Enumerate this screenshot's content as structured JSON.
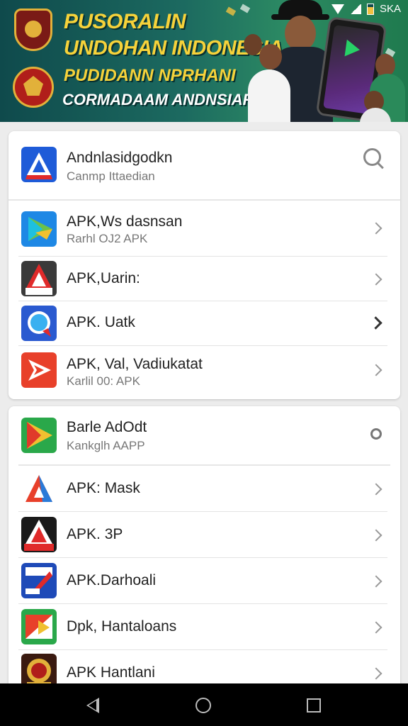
{
  "status_bar": {
    "carrier": "SKA"
  },
  "banner": {
    "line1": "PUSORALIN",
    "line2": "UNDOHAN INDONESIA",
    "line3": "PUDIDANN NPRHANI",
    "line4": "CORMADAAM ANDNSIAR"
  },
  "section1": {
    "header": {
      "title": "Andnlasidgodkn",
      "subtitle": "Canmp Ittaedian"
    },
    "items": [
      {
        "title": "APK,Ws dasnsan",
        "subtitle": "Rarhl OJ2 APK",
        "icon": "play-store-icon"
      },
      {
        "title": "APK,Uarin:",
        "subtitle": "",
        "icon": "apk-a-icon"
      },
      {
        "title": "APK. Uatk",
        "subtitle": "",
        "icon": "chat-bubble-icon"
      },
      {
        "title": "APK, Val, Vadiukatat",
        "subtitle": "Karlil 00: APK",
        "icon": "red-arrow-icon"
      }
    ]
  },
  "section2": {
    "header": {
      "title": "Barle AdOdt",
      "subtitle": "Kankglh AAPP"
    },
    "items": [
      {
        "title": "APK: Mask",
        "subtitle": "",
        "icon": "a-logo-icon"
      },
      {
        "title": "APK. 3P",
        "subtitle": "",
        "icon": "apk-red-icon"
      },
      {
        "title": "APK.Darhoali",
        "subtitle": "",
        "icon": "apk-blue-icon"
      },
      {
        "title": "Dpk, Hantaloans",
        "subtitle": "",
        "icon": "flag-icon"
      },
      {
        "title": "APK Hantlani",
        "subtitle": "",
        "icon": "emblem-icon"
      }
    ]
  },
  "colors": {
    "accent_yellow": "#f6d23a",
    "banner_bg": "#1c6a60"
  }
}
